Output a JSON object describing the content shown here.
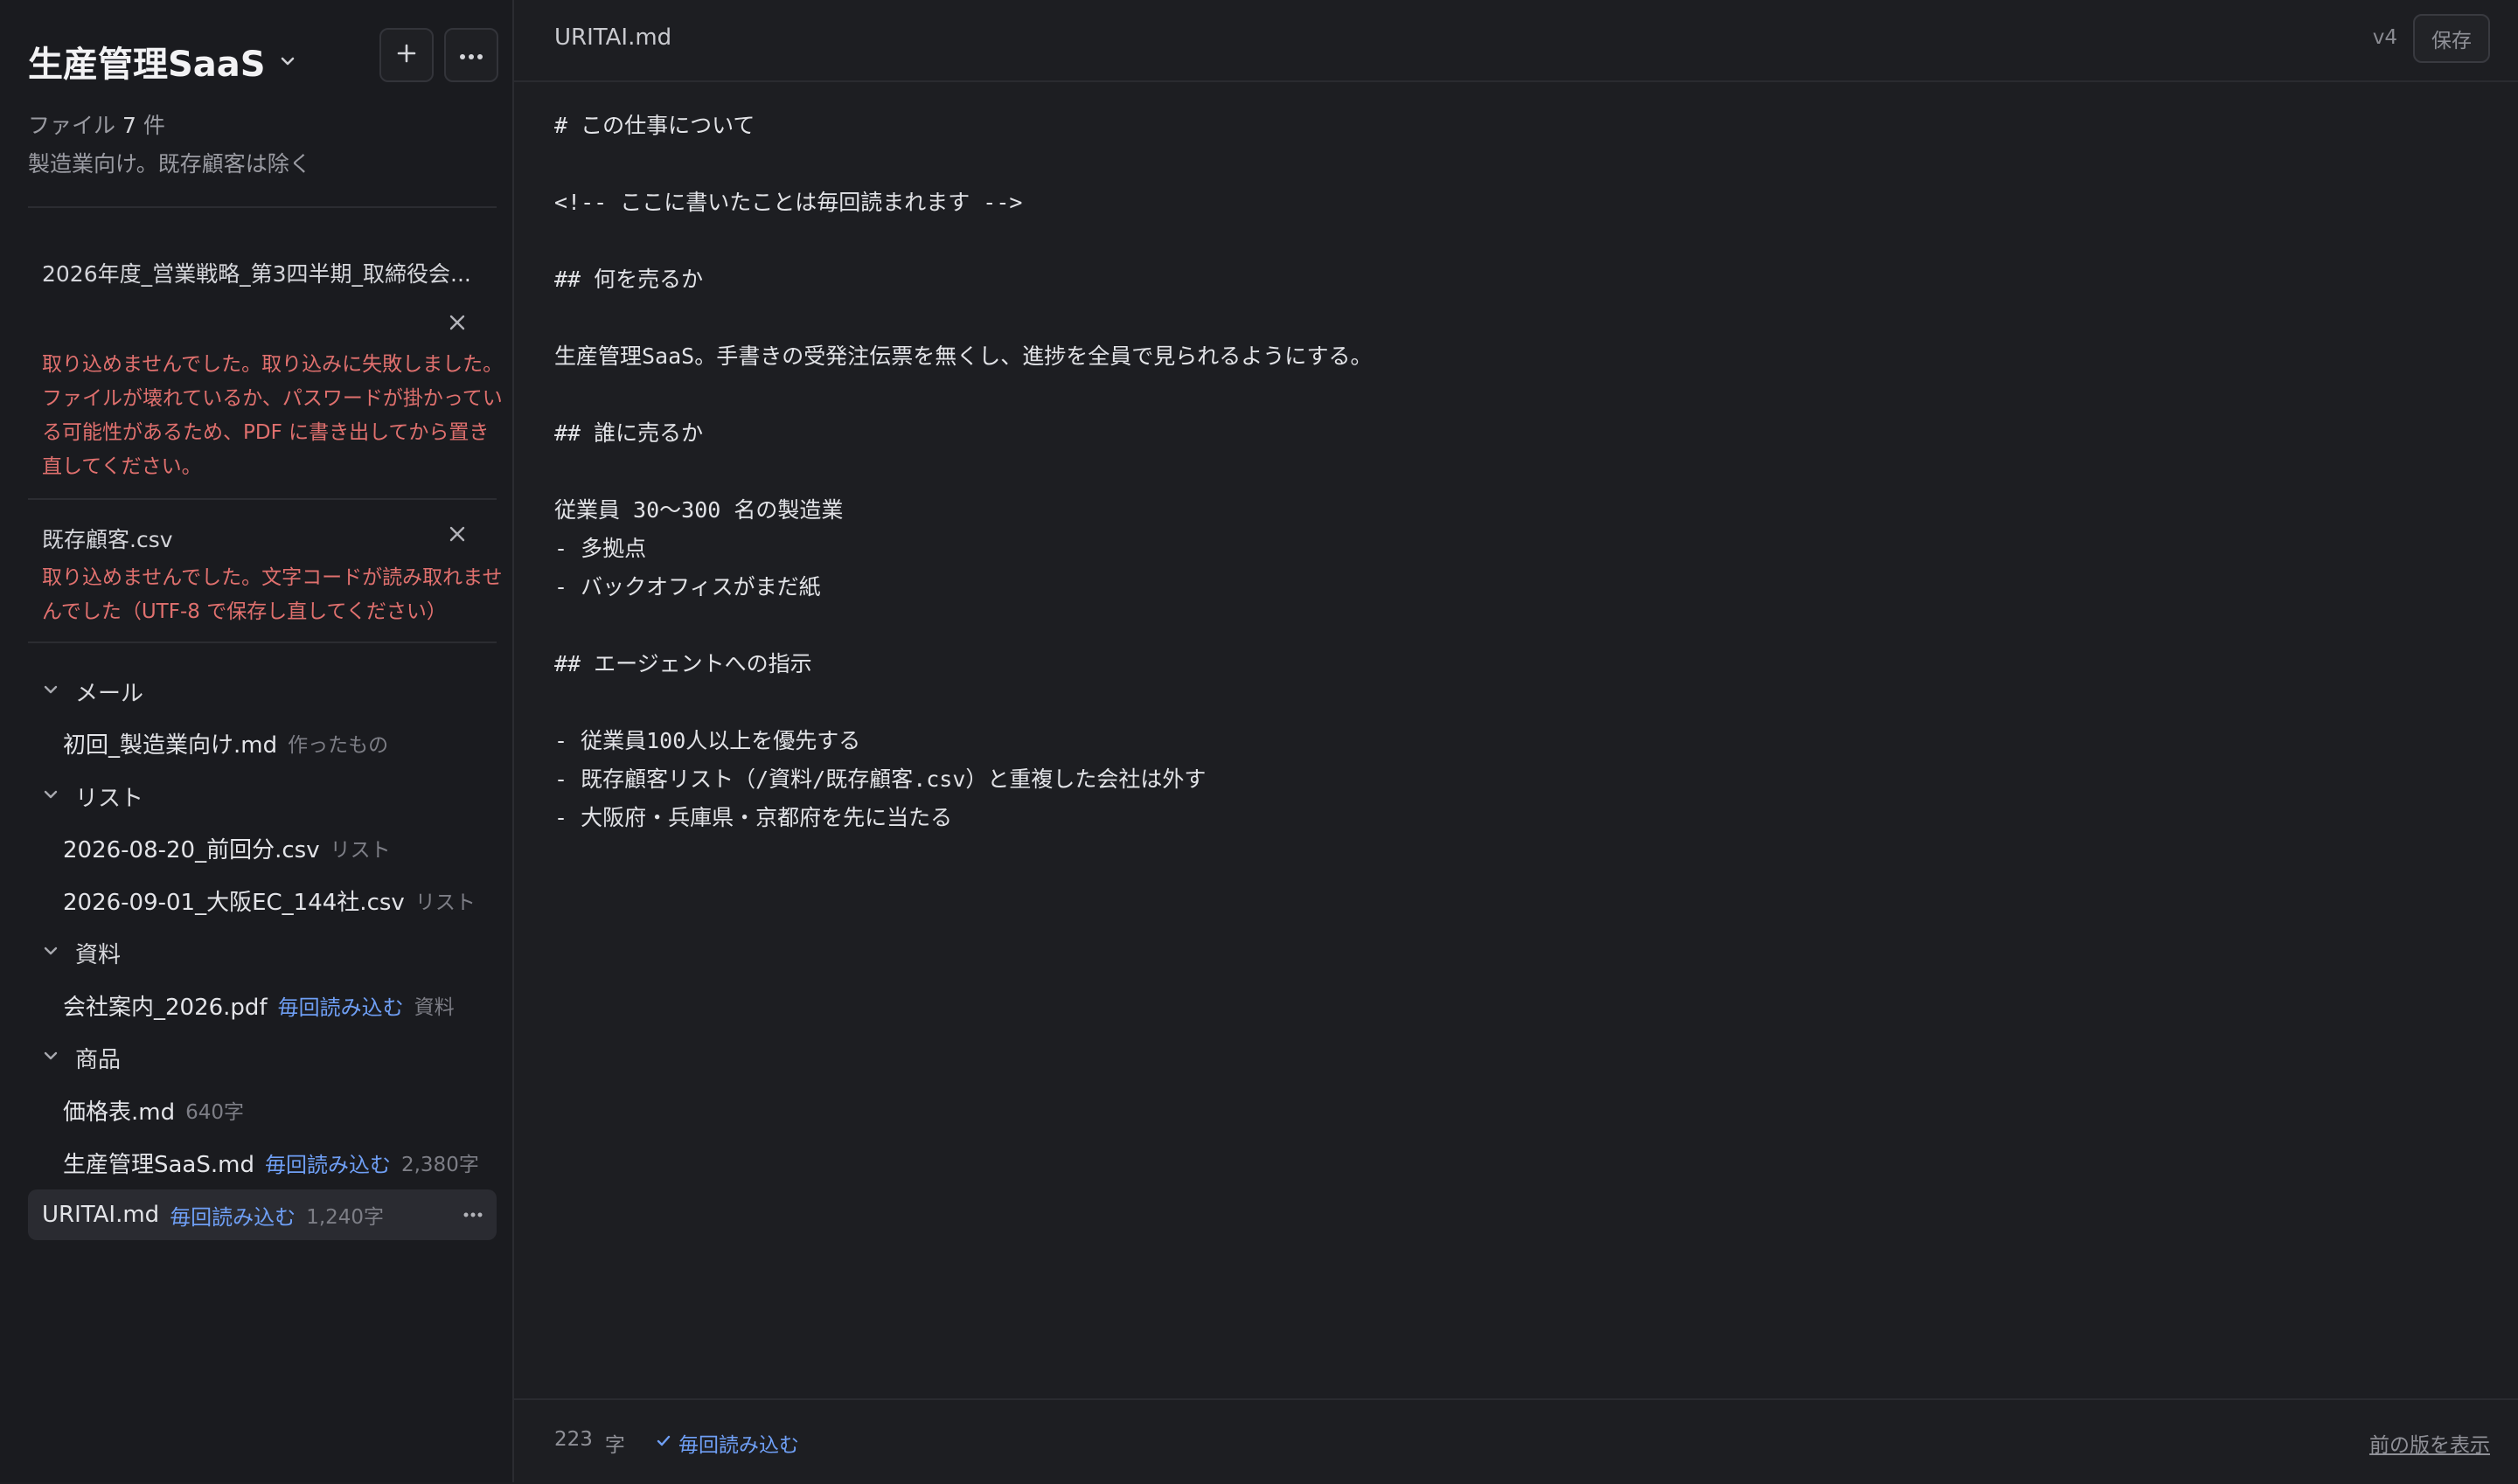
{
  "sidebar": {
    "project_title": "生産管理SaaS",
    "file_count_prefix": "ファイル",
    "file_count": "7",
    "file_count_suffix": "件",
    "description": "製造業向け。既存顧客は除く",
    "errors": [
      {
        "filename": "2026年度_営業戦略_第3四半期_取締役会...",
        "message": "取り込めませんでした。取り込みに失敗しました。ファイルが壊れているか、パスワードが掛かっている可能性があるため、PDF に書き出してから置き直してください。"
      },
      {
        "filename": "既存顧客.csv",
        "message": "取り込めませんでした。文字コードが読み取れませんでした（UTF-8 で保存し直してください）"
      }
    ],
    "folders": [
      {
        "label": "メール",
        "files": [
          {
            "name": "初回_製造業向け.md",
            "always": "",
            "meta": "作ったもの"
          }
        ]
      },
      {
        "label": "リスト",
        "files": [
          {
            "name": "2026-08-20_前回分.csv",
            "always": "",
            "meta": "リスト"
          },
          {
            "name": "2026-09-01_大阪EC_144社.csv",
            "always": "",
            "meta": "リスト"
          }
        ]
      },
      {
        "label": "資料",
        "files": [
          {
            "name": "会社案内_2026.pdf",
            "always": "毎回読み込む",
            "meta": "資料"
          }
        ]
      },
      {
        "label": "商品",
        "files": [
          {
            "name": "価格表.md",
            "always": "",
            "meta": "640字"
          },
          {
            "name": "生産管理SaaS.md",
            "always": "毎回読み込む",
            "meta": "2,380字"
          }
        ]
      }
    ],
    "active_file": {
      "name": "URITAI.md",
      "always": "毎回読み込む",
      "meta": "1,240字"
    }
  },
  "editor": {
    "title": "URITAI.md",
    "version": "v4",
    "save_label": "保存",
    "lines": [
      "# この仕事について",
      "",
      "<!-- ここに書いたことは毎回読まれます -->",
      "",
      "## 何を売るか",
      "",
      "生産管理SaaS。手書きの受発注伝票を無くし、進捗を全員で見られるようにする。",
      "",
      "## 誰に売るか",
      "",
      "従業員 30〜300 名の製造業",
      "- 多拠点",
      "- バックオフィスがまだ紙",
      "",
      "## エージェントへの指示",
      "",
      "- 従業員100人以上を優先する",
      "- 既存顧客リスト（/資料/既存顧客.csv）と重複した会社は外す",
      "- 大阪府・兵庫県・京都府を先に当たる"
    ],
    "char_count": "223",
    "char_unit": "字",
    "always_label": "毎回読み込む",
    "prev_version_label": "前の版を表示"
  },
  "icons": {
    "add": "plus-icon",
    "more": "more-horizontal-icon",
    "close": "close-icon",
    "chevron": "chevron-down-icon",
    "check": "check-icon"
  },
  "colors": {
    "accent": "#6f9ff5",
    "error": "#e0706e",
    "background": "#1d1e22"
  }
}
